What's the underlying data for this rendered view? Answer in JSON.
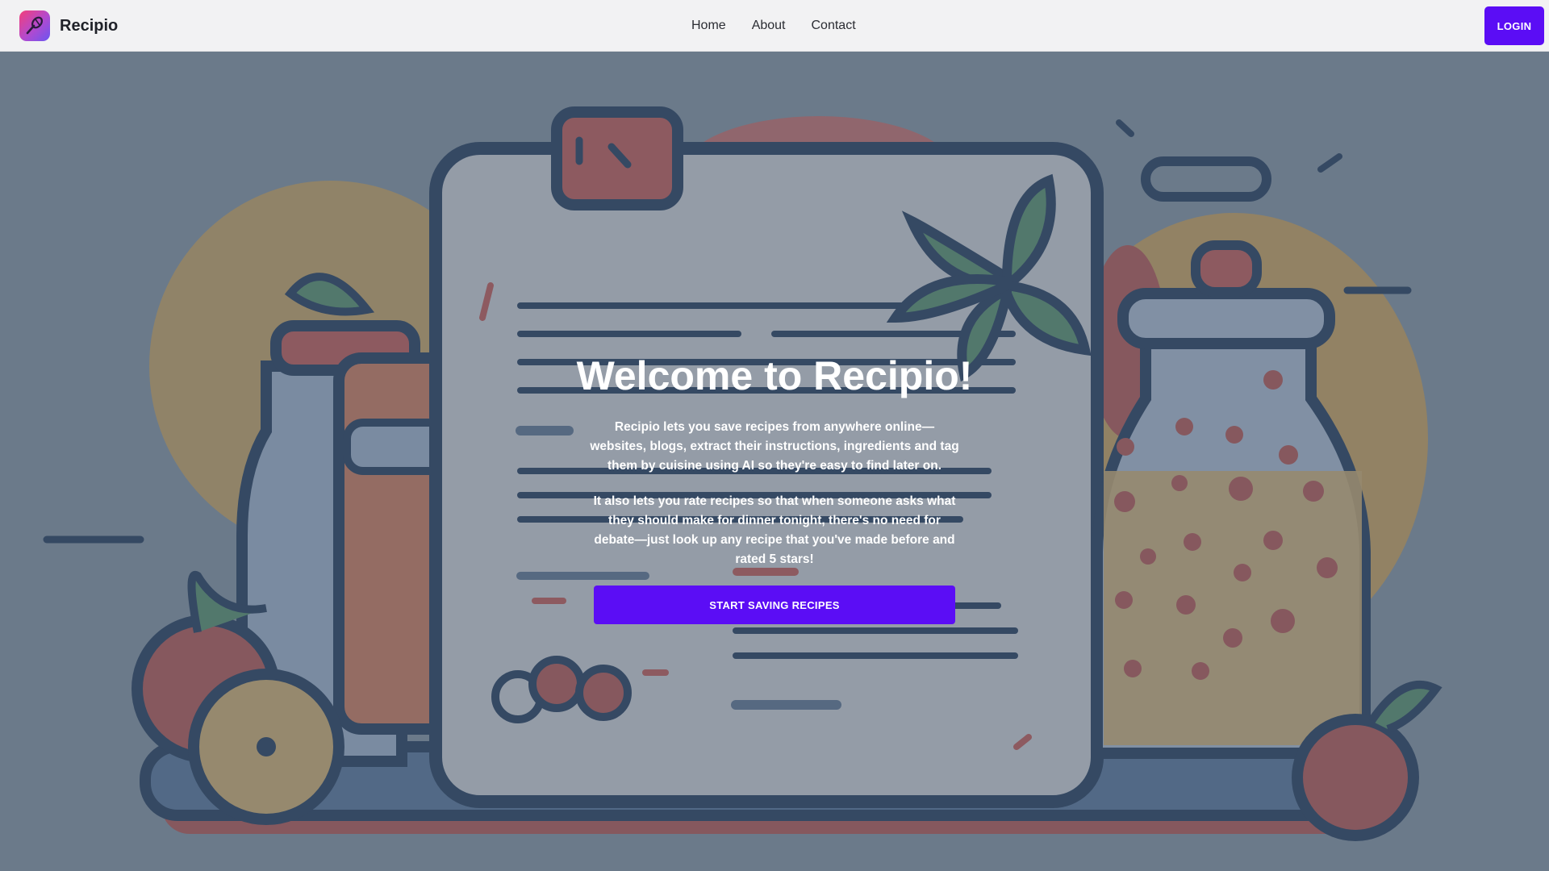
{
  "header": {
    "brand": "Recipio",
    "logo_icon": "whisk-icon",
    "nav": [
      {
        "label": "Home"
      },
      {
        "label": "About"
      },
      {
        "label": "Contact"
      }
    ],
    "login_label": "LOGIN"
  },
  "hero": {
    "title": "Welcome to Recipio!",
    "paragraph1": "Recipio lets you save recipes from anywhere online—websites, blogs, extract their instructions, ingredients and tag them by cuisine using AI so they're easy to find later on.",
    "paragraph2": "It also lets you rate recipes so that when someone asks what they should make for dinner tonight, there's no need for debate—just look up any recipe that you've made before and rated 5 stars!",
    "cta_label": "START SAVING RECIPES",
    "background_illustration": "kitchen-recipe-card-illustration"
  },
  "colors": {
    "accent": "#5b0df5",
    "header_bg": "#f2f2f3",
    "hero_overlay": "#5f6b76"
  }
}
